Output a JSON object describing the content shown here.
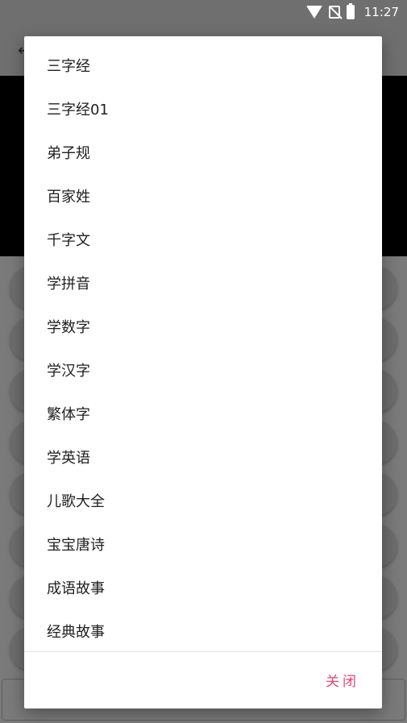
{
  "status_bar": {
    "time": "11:27",
    "icons": [
      "wifi-icon",
      "no-sim-icon",
      "battery-charging-icon"
    ]
  },
  "app_bar": {
    "back_icon": "back-arrow-icon"
  },
  "dialog": {
    "items": [
      {
        "label": "三字经"
      },
      {
        "label": "三字经01"
      },
      {
        "label": "弟子规"
      },
      {
        "label": "百家姓"
      },
      {
        "label": "千字文"
      },
      {
        "label": "学拼音"
      },
      {
        "label": "学数字"
      },
      {
        "label": "学汉字"
      },
      {
        "label": "繁体字"
      },
      {
        "label": "学英语"
      },
      {
        "label": "儿歌大全"
      },
      {
        "label": "宝宝唐诗"
      },
      {
        "label": "成语故事"
      },
      {
        "label": "经典故事"
      }
    ],
    "close_label": "关闭"
  },
  "colors": {
    "overlay": "#7a7a7a",
    "dialog_bg": "#ffffff",
    "close_accent": "#e0457b"
  }
}
